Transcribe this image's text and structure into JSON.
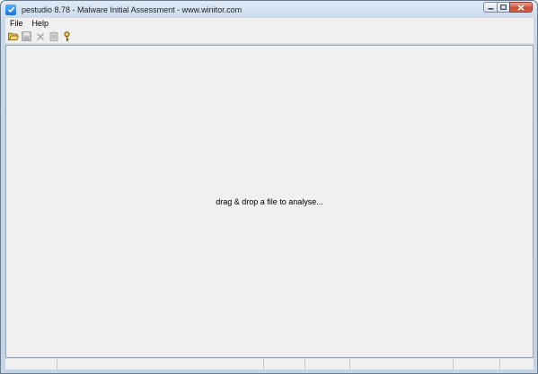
{
  "window": {
    "title": "pestudio 8.78 - Malware Initial Assessment - www.winitor.com",
    "app_icon": "pestudio-check-icon"
  },
  "caption_buttons": {
    "minimize_icon": "minimize-icon",
    "maximize_icon": "maximize-icon",
    "close_icon": "close-icon"
  },
  "menubar": {
    "items": [
      {
        "label": "File"
      },
      {
        "label": "Help"
      }
    ]
  },
  "toolbar": {
    "buttons": [
      {
        "icon": "open-folder-icon",
        "enabled": true
      },
      {
        "icon": "save-icon",
        "enabled": false
      },
      {
        "icon": "close-file-icon",
        "enabled": false
      },
      {
        "icon": "clipboard-icon",
        "enabled": false
      },
      {
        "icon": "key-icon",
        "enabled": true
      }
    ]
  },
  "content": {
    "placeholder": "drag & drop a file to analyse..."
  },
  "colors": {
    "title_gradient_top": "#dfe9f5",
    "title_gradient_bottom": "#c4d3e6",
    "client_bg": "#f0f0f0",
    "close_button": "#c94f36"
  }
}
